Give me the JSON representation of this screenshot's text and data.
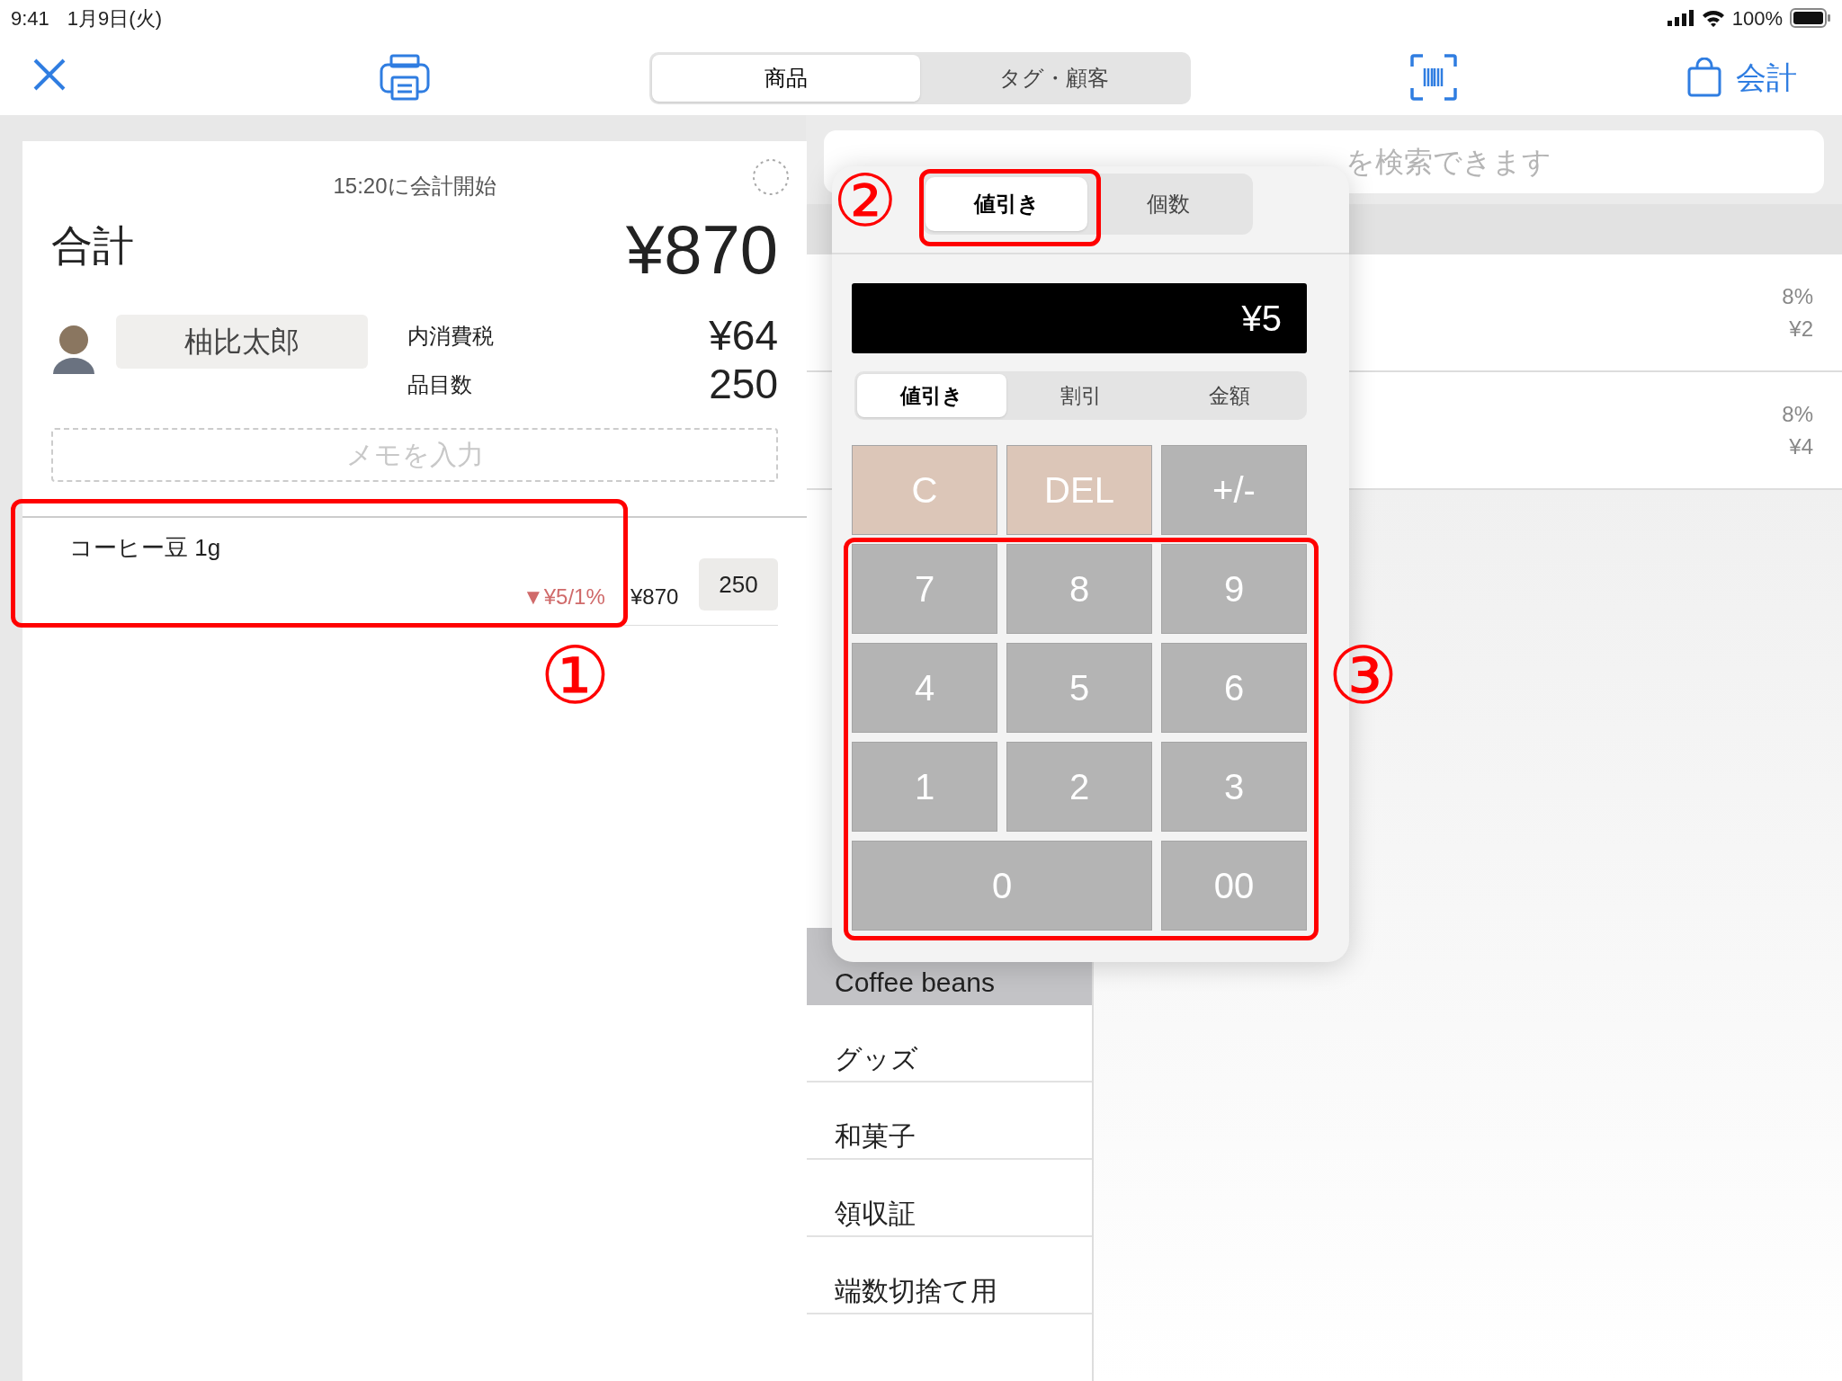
{
  "status_bar": {
    "time": "9:41",
    "date": "1月9日(火)",
    "battery": "100%"
  },
  "nav": {
    "tabs": [
      {
        "label": "商品",
        "selected": true
      },
      {
        "label": "タグ・顧客",
        "selected": false
      }
    ],
    "checkout": "会計"
  },
  "order": {
    "started": "15:20に会計開始",
    "total_label": "合計",
    "total": "¥870",
    "customer": "柚比太郎",
    "tax_label": "内消費税",
    "tax": "¥64",
    "count_label": "品目数",
    "count": "250",
    "memo": {
      "placeholder": "メモを入力"
    },
    "items": [
      {
        "name": "コーヒー豆 1g",
        "discount": "▼¥5/1%",
        "price": "¥870",
        "quantity": "250"
      }
    ]
  },
  "search": {
    "placeholder": "を検索できます"
  },
  "products": [
    {
      "tax": "8%",
      "price": "¥2"
    },
    {
      "tax": "8%",
      "price": "¥4"
    }
  ],
  "categories": [
    {
      "label": "Coffee beans",
      "selected": true
    },
    {
      "label": "グッズ",
      "selected": false
    },
    {
      "label": "和菓子",
      "selected": false
    },
    {
      "label": "領収証",
      "selected": false
    },
    {
      "label": "端数切捨て用",
      "selected": false
    }
  ],
  "popover": {
    "tabs": [
      {
        "label": "値引き",
        "selected": true
      },
      {
        "label": "個数",
        "selected": false
      }
    ],
    "display": "¥5",
    "modes": [
      {
        "label": "値引き",
        "selected": true
      },
      {
        "label": "割引",
        "selected": false
      },
      {
        "label": "金額",
        "selected": false
      }
    ],
    "keys": [
      {
        "label": "C",
        "kind": "action"
      },
      {
        "label": "DEL",
        "kind": "action"
      },
      {
        "label": "+/-",
        "kind": "sign"
      },
      {
        "label": "7",
        "kind": "digit"
      },
      {
        "label": "8",
        "kind": "digit"
      },
      {
        "label": "9",
        "kind": "digit"
      },
      {
        "label": "4",
        "kind": "digit"
      },
      {
        "label": "5",
        "kind": "digit"
      },
      {
        "label": "6",
        "kind": "digit"
      },
      {
        "label": "1",
        "kind": "digit"
      },
      {
        "label": "2",
        "kind": "digit"
      },
      {
        "label": "3",
        "kind": "digit"
      },
      {
        "label": "0",
        "kind": "wide"
      },
      {
        "label": "00",
        "kind": "digit"
      }
    ]
  },
  "annotations": [
    "①",
    "②",
    "③"
  ]
}
